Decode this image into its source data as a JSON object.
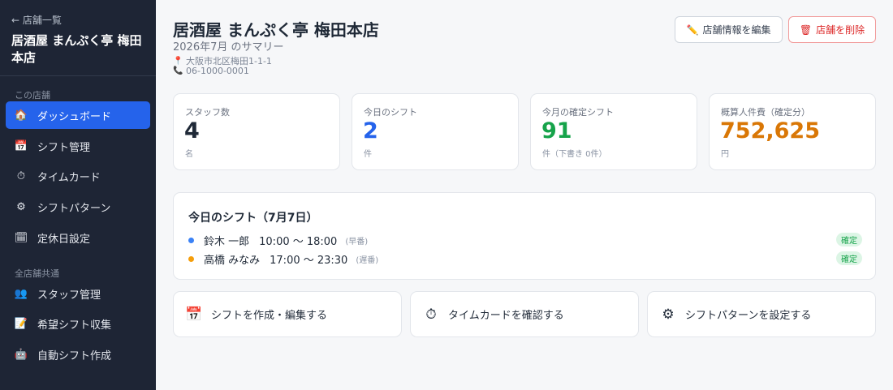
{
  "sidebar": {
    "back_label": "← 店舗一覧",
    "store_name": "居酒屋 まんぷく亭 梅田本店",
    "section_store": "この店舗",
    "section_common": "全店舗共通",
    "store_items": [
      {
        "label": "ダッシュボード",
        "icon": "house-icon",
        "glyph": "🏠",
        "active": true
      },
      {
        "label": "シフト管理",
        "icon": "calendar-icon",
        "glyph": "📅",
        "active": false
      },
      {
        "label": "タイムカード",
        "icon": "stopwatch-icon",
        "glyph": "⏱",
        "active": false
      },
      {
        "label": "シフトパターン",
        "icon": "gear-icon",
        "glyph": "⚙",
        "active": false
      },
      {
        "label": "定休日設定",
        "icon": "tear-off-calendar-icon",
        "glyph": "🗓",
        "active": false
      }
    ],
    "common_items": [
      {
        "label": "スタッフ管理",
        "icon": "people-icon",
        "glyph": "👥"
      },
      {
        "label": "希望シフト収集",
        "icon": "memo-icon",
        "glyph": "📝"
      },
      {
        "label": "自動シフト作成",
        "icon": "robot-icon",
        "glyph": "🤖"
      }
    ]
  },
  "header": {
    "title": "居酒屋 まんぷく亭 梅田本店",
    "summary": "2026年7月 のサマリー",
    "address": "大阪市北区梅田1-1-1",
    "phone": "06-1000-0001",
    "edit_button": "店舗情報を編集",
    "delete_button": "店舗を削除"
  },
  "stats": [
    {
      "label": "スタッフ数",
      "value": "4",
      "unit": "名",
      "color": "#1f2937"
    },
    {
      "label": "今日のシフト",
      "value": "2",
      "unit": "件",
      "color": "#2563eb"
    },
    {
      "label": "今月の確定シフト",
      "value": "91",
      "unit": "件（下書き 0件）",
      "color": "#16a34a"
    },
    {
      "label": "概算人件費（確定分）",
      "value": "752,625",
      "unit": "円",
      "color": "#d97706"
    }
  ],
  "today": {
    "title": "今日のシフト（7月7日）",
    "shifts": [
      {
        "name": "鈴木 一郎",
        "time": "10:00 〜 18:00",
        "kind": "(早番)",
        "status": "確定",
        "dot_color": "#3b82f6"
      },
      {
        "name": "高橋 みなみ",
        "time": "17:00 〜 23:30",
        "kind": "(遅番)",
        "status": "確定",
        "dot_color": "#f59e0b"
      }
    ]
  },
  "actions": [
    {
      "label": "シフトを作成・編集する",
      "icon": "calendar-icon",
      "glyph": "📅"
    },
    {
      "label": "タイムカードを確認する",
      "icon": "stopwatch-icon",
      "glyph": "⏱"
    },
    {
      "label": "シフトパターンを設定する",
      "icon": "gear-icon",
      "glyph": "⚙"
    }
  ]
}
